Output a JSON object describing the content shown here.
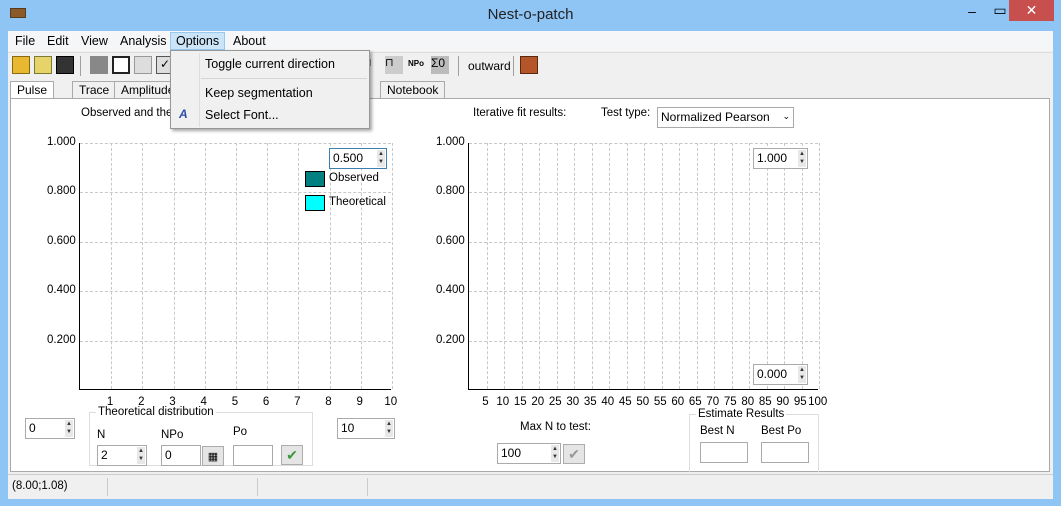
{
  "window": {
    "title": "Nest-o-patch",
    "minimize": "–",
    "maximize": "▭",
    "close": "✕"
  },
  "menu": [
    "File",
    "Edit",
    "View",
    "Analysis",
    "Options",
    "About"
  ],
  "options_menu": {
    "items": [
      "Toggle current direction",
      "Keep segmentation",
      "Select Font..."
    ]
  },
  "toolbar": {
    "direction_label": "outward"
  },
  "tabs": [
    "Pulse Tree",
    "Trace",
    "Amplitude",
    "Notebook"
  ],
  "left_panel": {
    "title": "Observed and theo",
    "y_ticks": [
      "1.000",
      "0.800",
      "0.600",
      "0.400",
      "0.200"
    ],
    "x_ticks": [
      "1",
      "2",
      "3",
      "4",
      "5",
      "6",
      "7",
      "8",
      "9",
      "10"
    ],
    "y_max_spin": "0.500",
    "legend": [
      {
        "label": "Observed",
        "color": "#008080"
      },
      {
        "label": "Theoretical",
        "color": "#00ffff"
      }
    ],
    "x_min_spin": "0",
    "x_max_spin": "10",
    "theoretical": {
      "title": "Theoretical distribution",
      "n_label": "N",
      "n_value": "2",
      "npo_label": "NPo",
      "npo_value": "0",
      "po_label": "Po",
      "po_value": ""
    }
  },
  "right_panel": {
    "title": "Iterative fit results:",
    "test_type_label": "Test type:",
    "test_type_value": "Normalized Pearson",
    "y_ticks": [
      "1.000",
      "0.800",
      "0.600",
      "0.400",
      "0.200"
    ],
    "x_ticks": [
      "5",
      "10",
      "15",
      "20",
      "25",
      "30",
      "35",
      "40",
      "45",
      "50",
      "55",
      "60",
      "65",
      "70",
      "75",
      "80",
      "85",
      "90",
      "95",
      "100"
    ],
    "y_max_spin": "1.000",
    "y_min_spin": "0.000",
    "max_n_label": "Max N to test:",
    "max_n_value": "100",
    "estimate": {
      "title": "Estimate Results",
      "best_n_label": "Best N",
      "best_n_value": "",
      "best_po_label": "Best Po",
      "best_po_value": ""
    }
  },
  "status": {
    "coords": "(8.00;1.08)"
  }
}
